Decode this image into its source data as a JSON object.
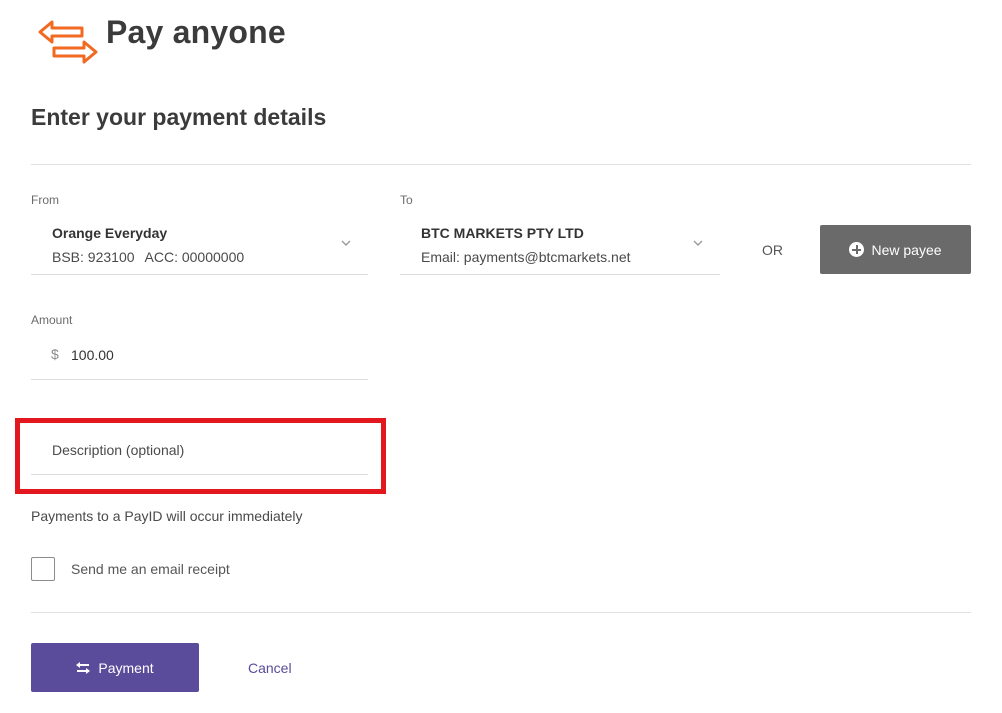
{
  "header": {
    "title": "Pay anyone",
    "icon": "transfer-arrows-icon",
    "icon_color": "#f26a21"
  },
  "section_title": "Enter your payment details",
  "from": {
    "label": "From",
    "account_name": "Orange Everyday",
    "bsb": "BSB: 923100",
    "acc": "ACC: 00000000"
  },
  "to": {
    "label": "To",
    "payee_name": "BTC MARKETS PTY LTD",
    "payee_detail": "Email: payments@btcmarkets.net"
  },
  "or_text": "OR",
  "new_payee_button": {
    "label": "New payee",
    "icon": "plus-circle-icon",
    "color": "#6a6a6a"
  },
  "amount": {
    "label": "Amount",
    "currency_symbol": "$",
    "value": "100.00"
  },
  "description": {
    "placeholder": "Description (optional)",
    "highlight_color": "#e3171e"
  },
  "info_text": "Payments to a PayID will occur immediately",
  "email_receipt": {
    "label": "Send me an email receipt",
    "checked": false
  },
  "payment_button": {
    "label": "Payment",
    "icon": "swap-arrows-icon",
    "color": "#5a4c9a"
  },
  "cancel_link": "Cancel"
}
